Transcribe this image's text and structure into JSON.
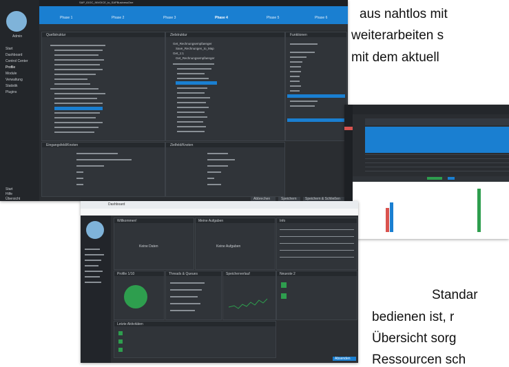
{
  "paragraph": {
    "line1": "aus nahtlos mit",
    "line2": "weiterarbeiten s",
    "line3": "mit dem aktuell",
    "line4": "Standar",
    "line5": "bedienen ist, r",
    "line6": "Übersicht sorg",
    "line7": "Ressourcen sch"
  },
  "main_screenshot": {
    "user_name": "Admin",
    "tab_label": "SAP_IDOC_INVOICE_to_SAPBusinessOne",
    "phases": [
      "Phase 1",
      "Phase 2",
      "Phase 3",
      "Phase 4",
      "Phase 5",
      "Phase 6"
    ],
    "sidebar_items": [
      "Start",
      "Dashboard",
      "Control Center",
      "Profile",
      "Module",
      "Verwaltung",
      "Statistik",
      "Plugins"
    ],
    "sidebar_footer": [
      "Start",
      "Hilfe",
      "Übersicht"
    ],
    "panel_left_title": "Quellstruktur",
    "panel_mid_title": "Zielstruktur",
    "panel_right_title": "Funktionen",
    "panel_bottom_left_title": "Eingangsfeld/Knoten",
    "panel_bottom_mid_title": "Zielfeld/Knoten",
    "target_items": [
      "Get_Rechnungsempfaenger",
      "Save_Rechnungen_to_Map",
      "Get_1:1",
      "Get_Rechnungsempfaenger"
    ],
    "buttons": {
      "cancel": "Abbrechen",
      "save": "Speichern",
      "save_close": "Speichern & Schließen"
    }
  },
  "dashboard_screenshot": {
    "browser_title": "Dashboard",
    "panels": [
      "Willkommen!",
      "Meine Aufgaben",
      "Info",
      "Profile 1/10",
      "Threads & Queues",
      "Speicherverlauf",
      "Neueste 2",
      "Letzte Aktivitäten"
    ],
    "empty_msg1": "Keine Daten",
    "empty_msg2": "Keine Aufgaben",
    "footer_button": "Absenden"
  },
  "colors": {
    "accent": "#1a7fd1",
    "dark_bg": "#2a2d31",
    "alert": "#d9534f",
    "success": "#2e9e4e"
  }
}
